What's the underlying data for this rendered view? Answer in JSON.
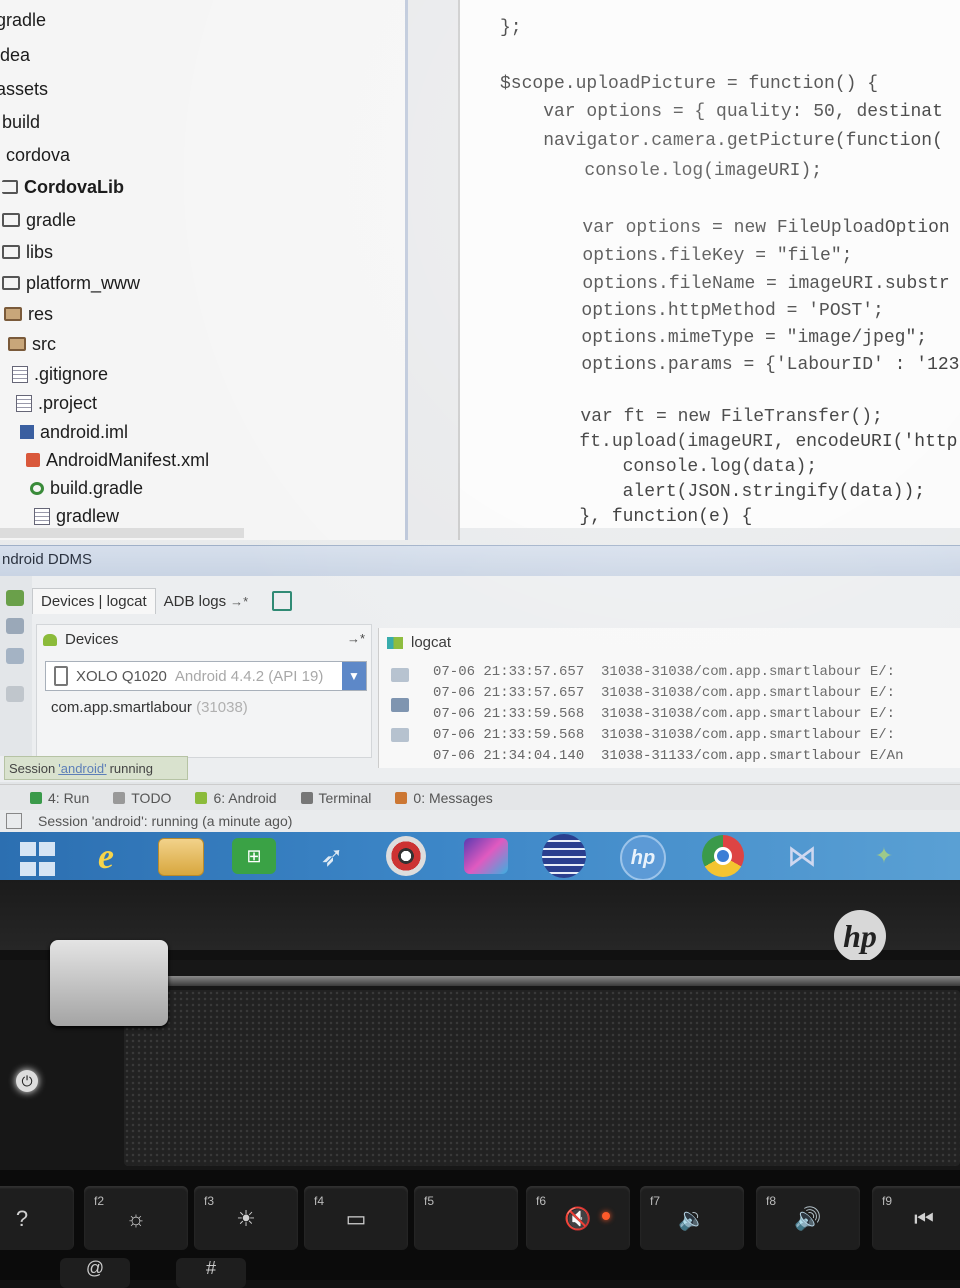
{
  "project_tree": [
    {
      "label": "gradle",
      "icon": "folder-icon"
    },
    {
      "label": "idea",
      "icon": "folder-icon"
    },
    {
      "label": "assets",
      "icon": "folder-icon"
    },
    {
      "label": "build",
      "icon": "folder-icon"
    },
    {
      "label": "cordova",
      "icon": "folder-icon"
    },
    {
      "label": "CordovaLib",
      "icon": "module-folder-icon",
      "bold": true
    },
    {
      "label": "gradle",
      "icon": "folder-icon"
    },
    {
      "label": "libs",
      "icon": "folder-icon"
    },
    {
      "label": "platform_www",
      "icon": "folder-icon"
    },
    {
      "label": "res",
      "icon": "resource-folder-icon"
    },
    {
      "label": "src",
      "icon": "source-folder-icon"
    },
    {
      "label": ".gitignore",
      "icon": "text-file-icon"
    },
    {
      "label": ".project",
      "icon": "text-file-icon"
    },
    {
      "label": "android.iml",
      "icon": "iml-file-icon"
    },
    {
      "label": "AndroidManifest.xml",
      "icon": "xml-file-icon"
    },
    {
      "label": "build.gradle",
      "icon": "gradle-file-icon"
    },
    {
      "label": "gradlew",
      "icon": "text-file-icon"
    }
  ],
  "editor": {
    "lines": [
      {
        "text": "};"
      },
      {
        "text": ""
      },
      {
        "text": "$scope.uploadPicture = function() {"
      },
      {
        "text": "    var options = { quality: 50, destinat"
      },
      {
        "text": "    navigator.camera.getPicture(function("
      },
      {
        "text": "        console.log(imageURI);"
      },
      {
        "text": ""
      },
      {
        "text": "        var options = new FileUploadOption"
      },
      {
        "text": "        options.fileKey = \"file\";"
      },
      {
        "text": "        options.fileName = imageURI.substr"
      },
      {
        "text": "        options.httpMethod = 'POST';"
      },
      {
        "text": "        options.mimeType = \"image/jpeg\";"
      },
      {
        "text": "        options.params = {'LabourID' : '123"
      },
      {
        "text": ""
      },
      {
        "text": "        var ft = new FileTransfer();"
      },
      {
        "text": "        ft.upload(imageURI, encodeURI('http:"
      },
      {
        "text": "            console.log(data);"
      },
      {
        "text": "            alert(JSON.stringify(data));"
      },
      {
        "text": "        }, function(e) {"
      }
    ]
  },
  "ddms": {
    "title": "ndroid DDMS",
    "tabs": [
      {
        "label": "Devices | logcat"
      },
      {
        "label": "ADB logs"
      }
    ],
    "tab_arrow": "→*",
    "devices": {
      "title": "Devices",
      "pin": "→*",
      "device_name": "XOLO Q1020",
      "device_os": "Android 4.4.2 (API 19)",
      "process_name": "com.app.smartlabour",
      "process_pid": "(31038)"
    },
    "logcat": {
      "title": "logcat",
      "lines": [
        {
          "text": "07-06 21:33:57.657  31038-31038/com.app.smartlabour E/:"
        },
        {
          "text": "07-06 21:33:57.657  31038-31038/com.app.smartlabour E/:"
        },
        {
          "text": "07-06 21:33:59.568  31038-31038/com.app.smartlabour E/:"
        },
        {
          "text": "07-06 21:33:59.568  31038-31038/com.app.smartlabour E/:"
        },
        {
          "text": "07-06 21:34:04.140  31038-31133/com.app.smartlabour E/An"
        }
      ]
    },
    "session": {
      "prefix": "Session",
      "name": "'android'",
      "suffix": "running"
    }
  },
  "bottom_tabs": [
    {
      "label": "4: Run",
      "color": "#3a9a4a"
    },
    {
      "label": "TODO",
      "color": "#999999"
    },
    {
      "label": "6: Android",
      "color": "#8bbb3a"
    },
    {
      "label": "Terminal",
      "color": "#777777"
    },
    {
      "label": "0: Messages",
      "color": "#cc7733"
    }
  ],
  "status_bar": {
    "text": "Session 'android': running (a minute ago)"
  },
  "taskbar": {
    "apps": [
      "windows-start-icon",
      "internet-explorer-icon",
      "file-explorer-icon",
      "store-icon",
      "rocket-icon",
      "media-icon",
      "game-icon",
      "eclipse-icon",
      "hp-icon",
      "chrome-icon",
      "visual-studio-icon",
      "misc-app-icon"
    ]
  },
  "laptop": {
    "brand": "hp",
    "power_glyph": "⏻",
    "keys": [
      {
        "fn": "",
        "glyph": "?"
      },
      {
        "fn": "f2",
        "glyph": "☼"
      },
      {
        "fn": "f3",
        "glyph": "☀"
      },
      {
        "fn": "f4",
        "glyph": "▭"
      },
      {
        "fn": "f5",
        "glyph": ""
      },
      {
        "fn": "f6",
        "glyph": "🔇"
      },
      {
        "fn": "f7",
        "glyph": "🔉"
      },
      {
        "fn": "f8",
        "glyph": "🔊"
      },
      {
        "fn": "f9",
        "glyph": "⏮"
      }
    ],
    "row2": [
      "@",
      "#"
    ]
  },
  "colors": {
    "ddms_header": "#c9d4e4",
    "taskbar": "#3c86c7",
    "led": "#ff5a2a"
  }
}
